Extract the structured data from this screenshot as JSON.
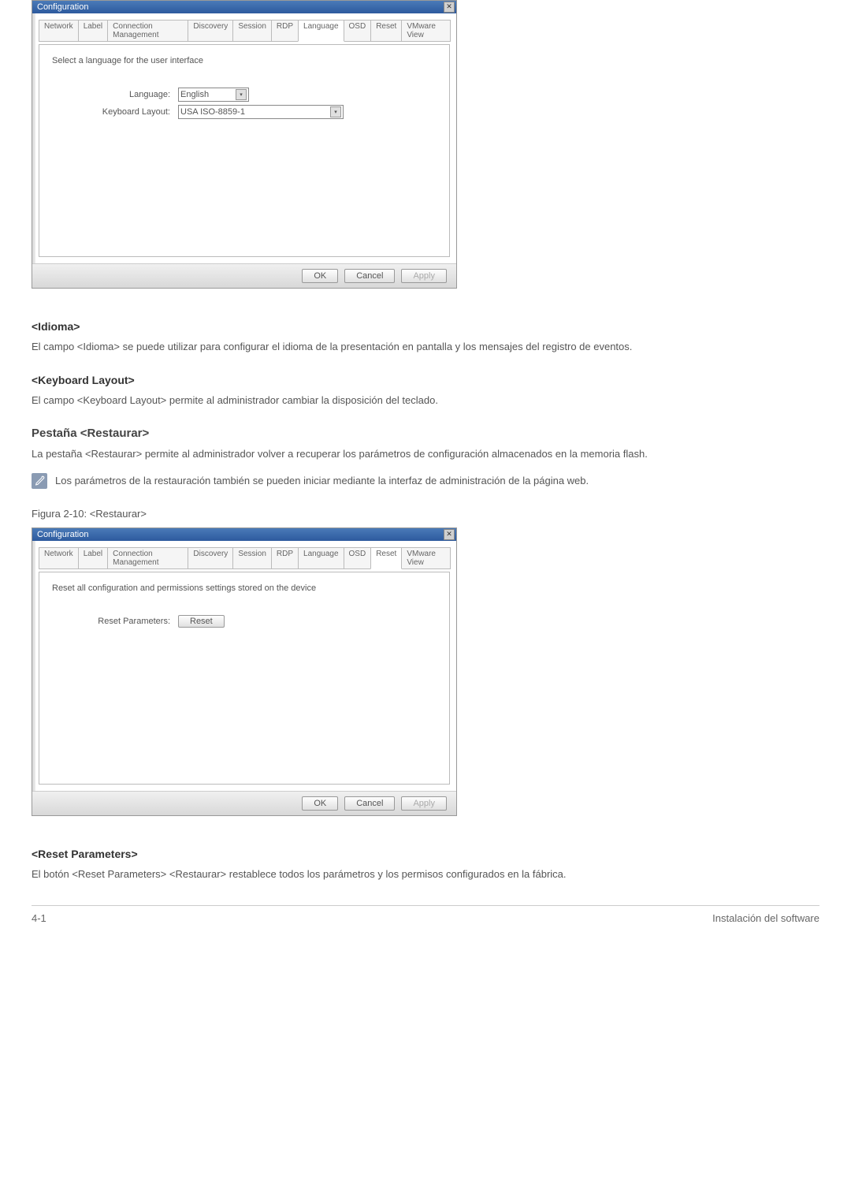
{
  "dialog1": {
    "title": "Configuration",
    "tabs": [
      "Network",
      "Label",
      "Connection Management",
      "Discovery",
      "Session",
      "RDP",
      "Language",
      "OSD",
      "Reset",
      "VMware View"
    ],
    "active_tab": "Language",
    "instruction": "Select a language for the user interface",
    "language_label": "Language:",
    "language_value": "English",
    "keyboard_label": "Keyboard Layout:",
    "keyboard_value": "USA ISO-8859-1",
    "ok": "OK",
    "cancel": "Cancel",
    "apply": "Apply"
  },
  "sec_idioma": {
    "title": "<Idioma>",
    "text": "El campo <Idioma> se puede utilizar para configurar el idioma de la presentación en pantalla y los mensajes del registro de eventos."
  },
  "sec_keyboard": {
    "title": "<Keyboard Layout>",
    "text": "El campo <Keyboard Layout> permite al administrador cambiar la disposición del teclado."
  },
  "sec_restaurar": {
    "title": "Pestaña <Restaurar>",
    "text": "La pestaña <Restaurar> permite al administrador volver a recuperar los parámetros de configuración almacenados en la memoria flash.",
    "note": "Los parámetros de la restauración también se pueden iniciar mediante la interfaz de administración de la página web."
  },
  "figure_caption": "Figura 2-10: <Restaurar>",
  "dialog2": {
    "title": "Configuration",
    "tabs": [
      "Network",
      "Label",
      "Connection Management",
      "Discovery",
      "Session",
      "RDP",
      "Language",
      "OSD",
      "Reset",
      "VMware View"
    ],
    "active_tab": "Reset",
    "instruction": "Reset all configuration and permissions settings stored on the device",
    "reset_label": "Reset Parameters:",
    "reset_button": "Reset",
    "ok": "OK",
    "cancel": "Cancel",
    "apply": "Apply"
  },
  "sec_reset_params": {
    "title": "<Reset Parameters>",
    "text": "El botón <Reset Parameters> <Restaurar> restablece todos los parámetros y los permisos configurados en la fábrica."
  },
  "footer": {
    "left": "4-1",
    "right": "Instalación del software"
  }
}
